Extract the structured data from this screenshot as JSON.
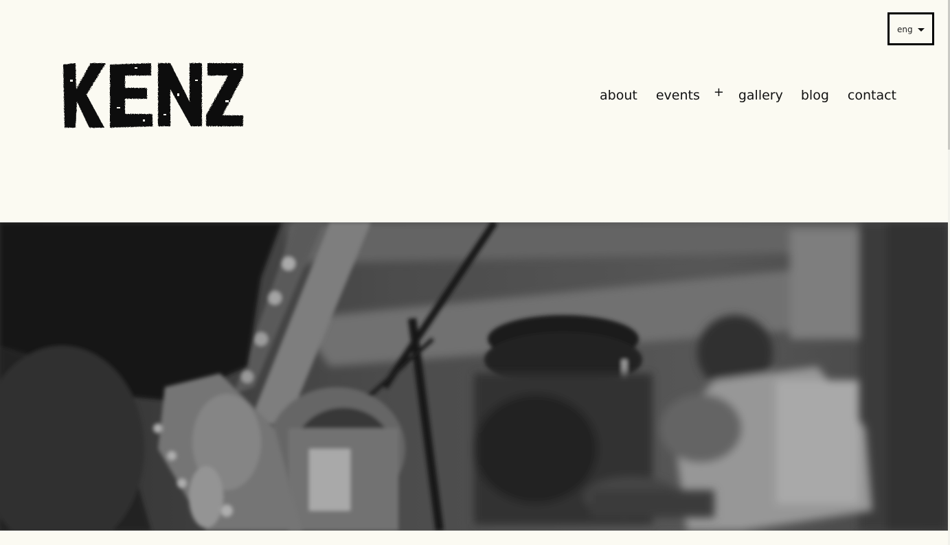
{
  "brand": {
    "logo_text": "KENZ"
  },
  "language": {
    "selected": "eng",
    "icon": "caret-down-icon"
  },
  "nav": {
    "items": [
      {
        "label": "about"
      },
      {
        "label": "events"
      },
      {
        "label": "+"
      },
      {
        "label": "gallery"
      },
      {
        "label": "blog"
      },
      {
        "label": "contact"
      }
    ]
  },
  "colors": {
    "background": "#fbfaf2",
    "text": "#111111"
  }
}
